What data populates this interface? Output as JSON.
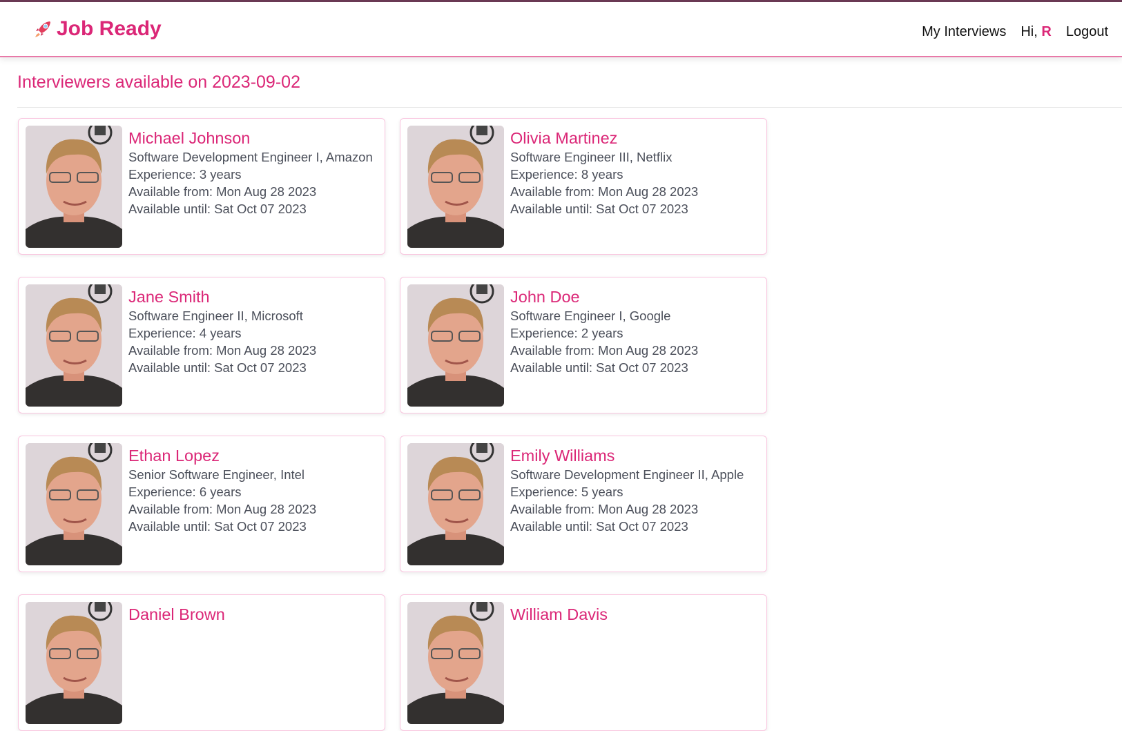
{
  "header": {
    "brand": "Job Ready",
    "brand_icon": "rocket-icon",
    "nav": {
      "my_interviews": "My Interviews",
      "greeting": "Hi,",
      "user_initial": "R",
      "logout": "Logout"
    }
  },
  "page": {
    "title": "Interviewers available on 2023-09-02"
  },
  "colors": {
    "accent": "#db2777",
    "card_border": "#f9c4de"
  },
  "interviewers": [
    {
      "name": "Michael Johnson",
      "role": "Software Development Engineer I, Amazon",
      "experience": "Experience: 3 years",
      "from": "Available from: Mon Aug 28 2023",
      "until": "Available until: Sat Oct 07 2023"
    },
    {
      "name": "Olivia Martinez",
      "role": "Software Engineer III, Netflix",
      "experience": "Experience: 8 years",
      "from": "Available from: Mon Aug 28 2023",
      "until": "Available until: Sat Oct 07 2023"
    },
    {
      "name": "Jane Smith",
      "role": "Software Engineer II, Microsoft",
      "experience": "Experience: 4 years",
      "from": "Available from: Mon Aug 28 2023",
      "until": "Available until: Sat Oct 07 2023"
    },
    {
      "name": "John Doe",
      "role": "Software Engineer I, Google",
      "experience": "Experience: 2 years",
      "from": "Available from: Mon Aug 28 2023",
      "until": "Available until: Sat Oct 07 2023"
    },
    {
      "name": "Ethan Lopez",
      "role": "Senior Software Engineer, Intel",
      "experience": "Experience: 6 years",
      "from": "Available from: Mon Aug 28 2023",
      "until": "Available until: Sat Oct 07 2023"
    },
    {
      "name": "Emily Williams",
      "role": "Software Development Engineer II, Apple",
      "experience": "Experience: 5 years",
      "from": "Available from: Mon Aug 28 2023",
      "until": "Available until: Sat Oct 07 2023"
    },
    {
      "name": "Daniel Brown"
    },
    {
      "name": "William Davis"
    }
  ]
}
